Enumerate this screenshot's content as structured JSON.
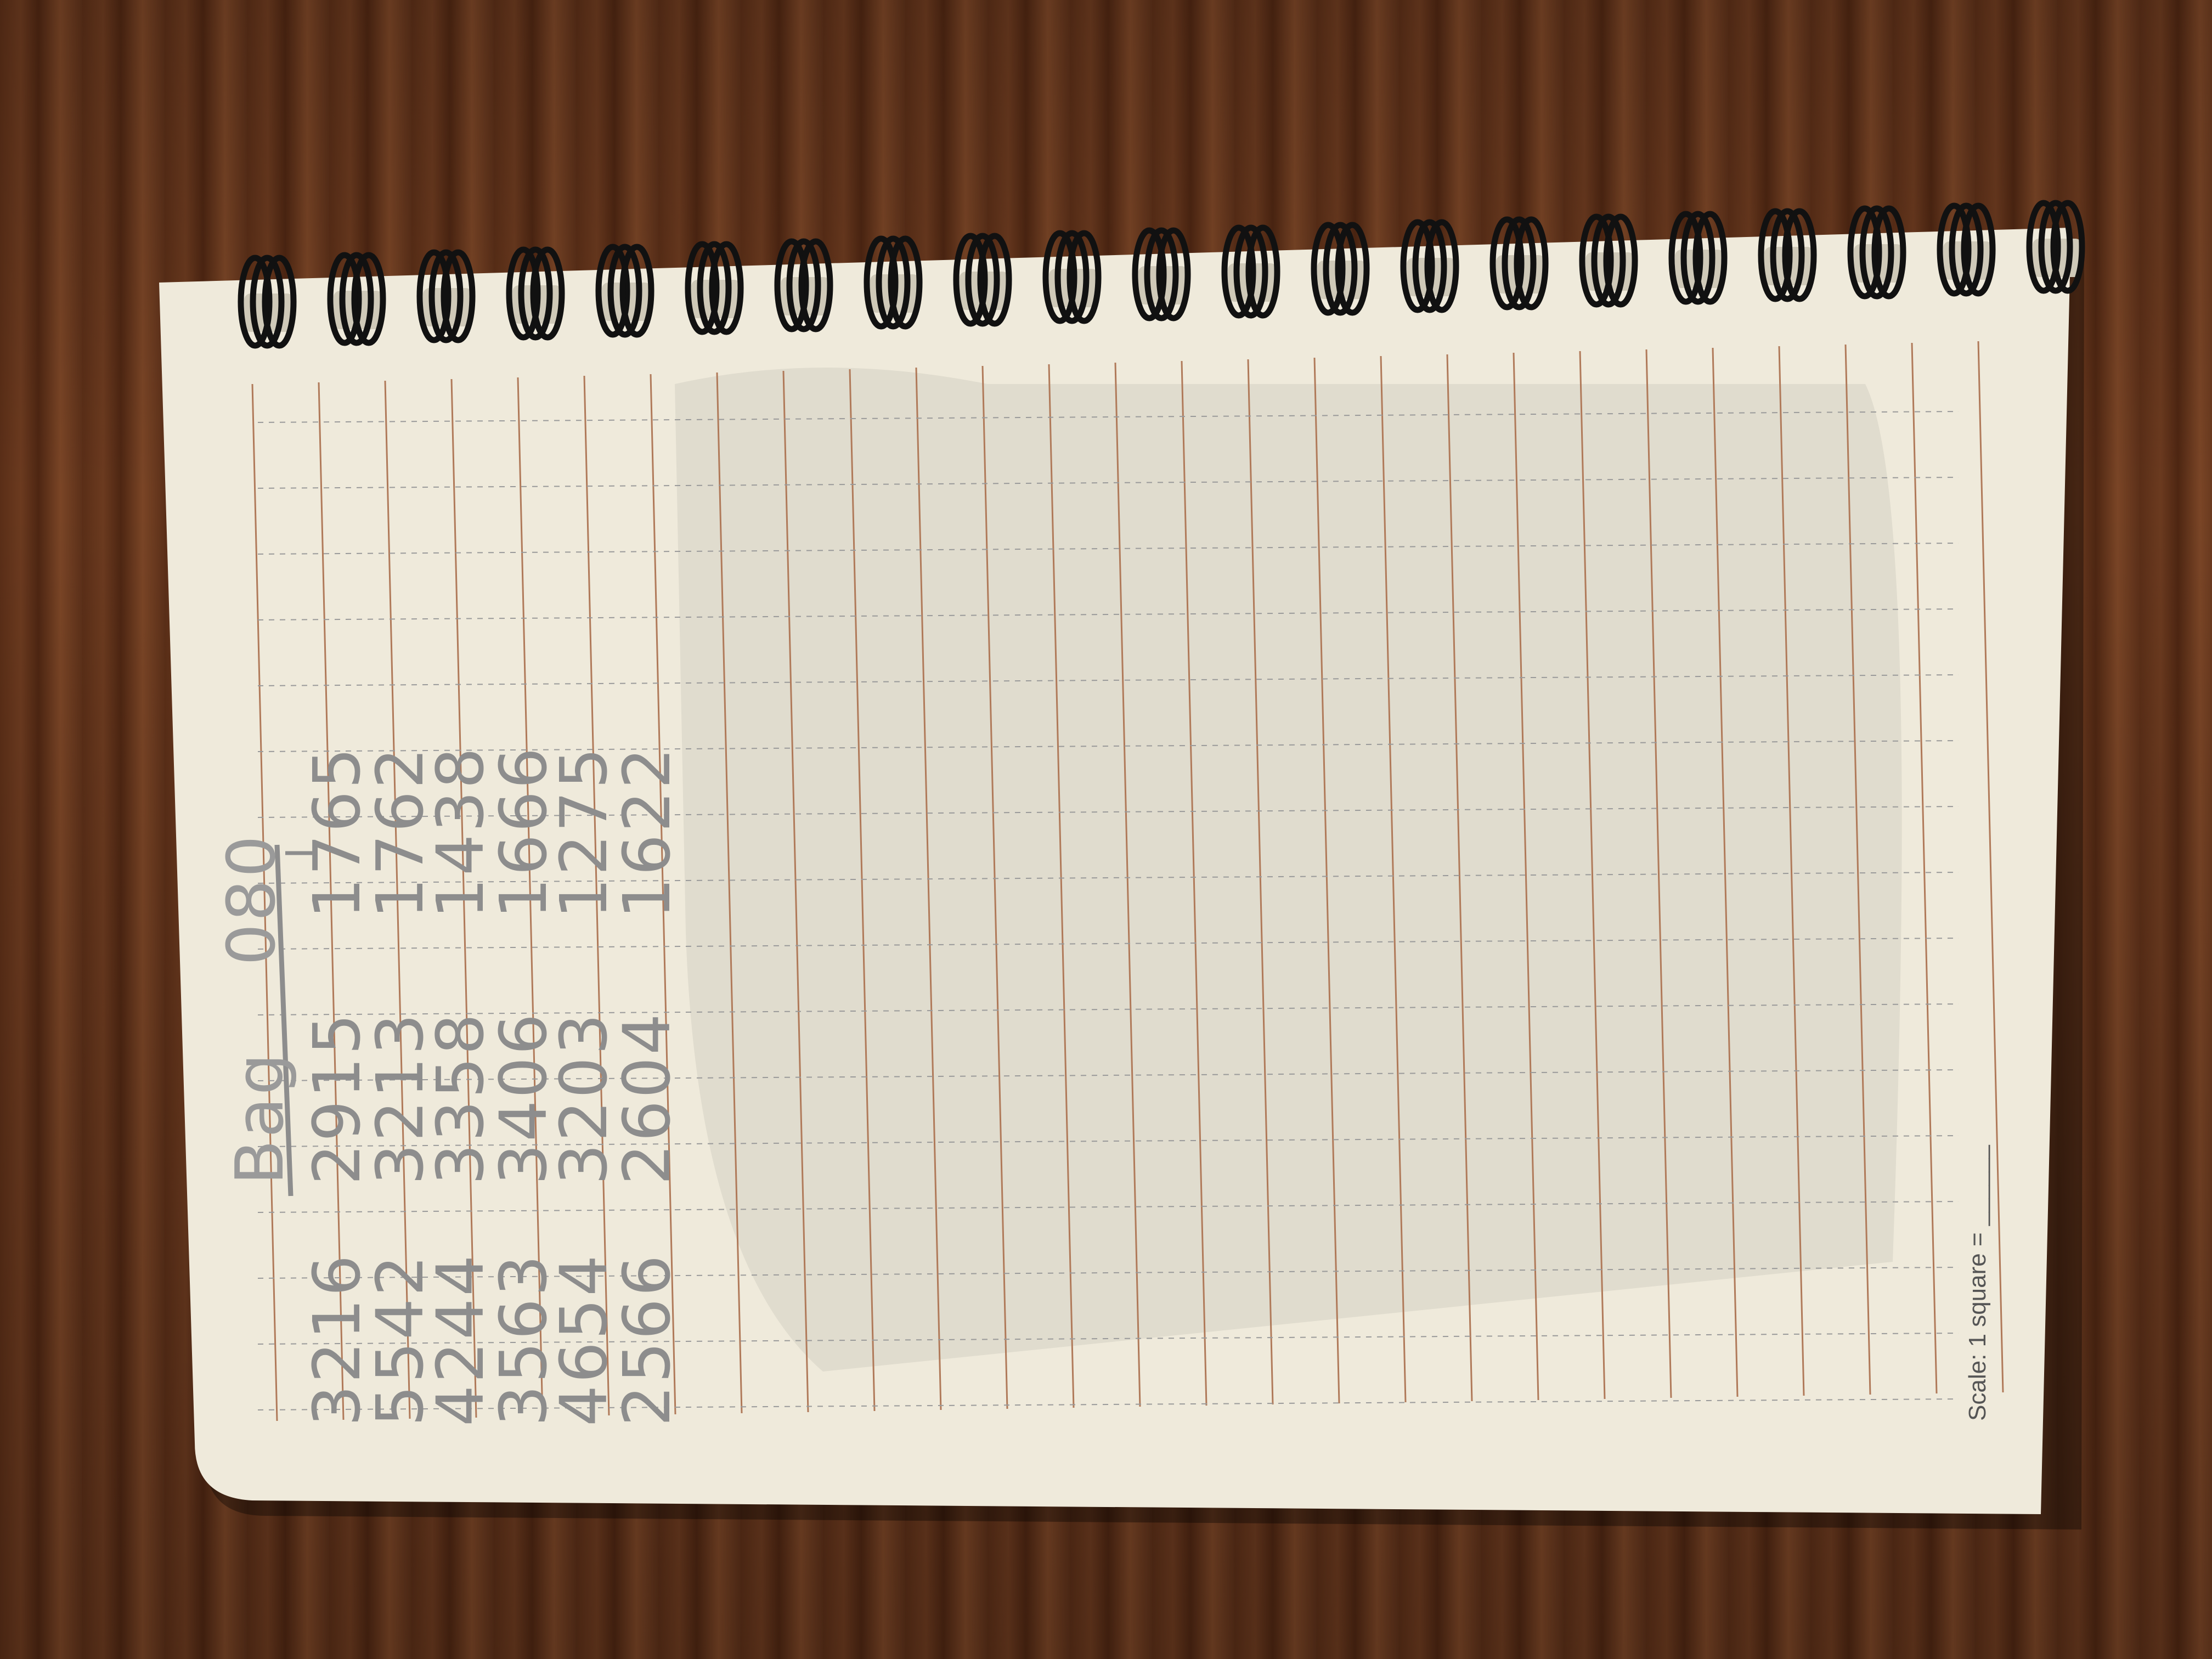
{
  "notebook": {
    "header": {
      "label": "Bag",
      "number": "080"
    },
    "rows": [
      {
        "col1": "3216",
        "col2": "2915",
        "col3": "1765"
      },
      {
        "col1": "5542",
        "col2": "3213",
        "col3": "1762"
      },
      {
        "col1": "4244",
        "col2": "3358",
        "col3": "1438"
      },
      {
        "col1": "3563",
        "col2": "3406",
        "col3": "1666"
      },
      {
        "col1": "4654",
        "col2": "3203",
        "col3": "1275"
      },
      {
        "col1": "2566",
        "col2": "2604",
        "col3": "1622"
      }
    ],
    "footer": {
      "scale_label": "Scale: 1 square = ______"
    }
  },
  "colors": {
    "paper": "#efeadb",
    "rule_line": "#b07a5a",
    "dotted_line": "#9a9a9a",
    "pencil": "#8d8d8d",
    "wood": "#5a2e17",
    "coil": "#111111"
  }
}
